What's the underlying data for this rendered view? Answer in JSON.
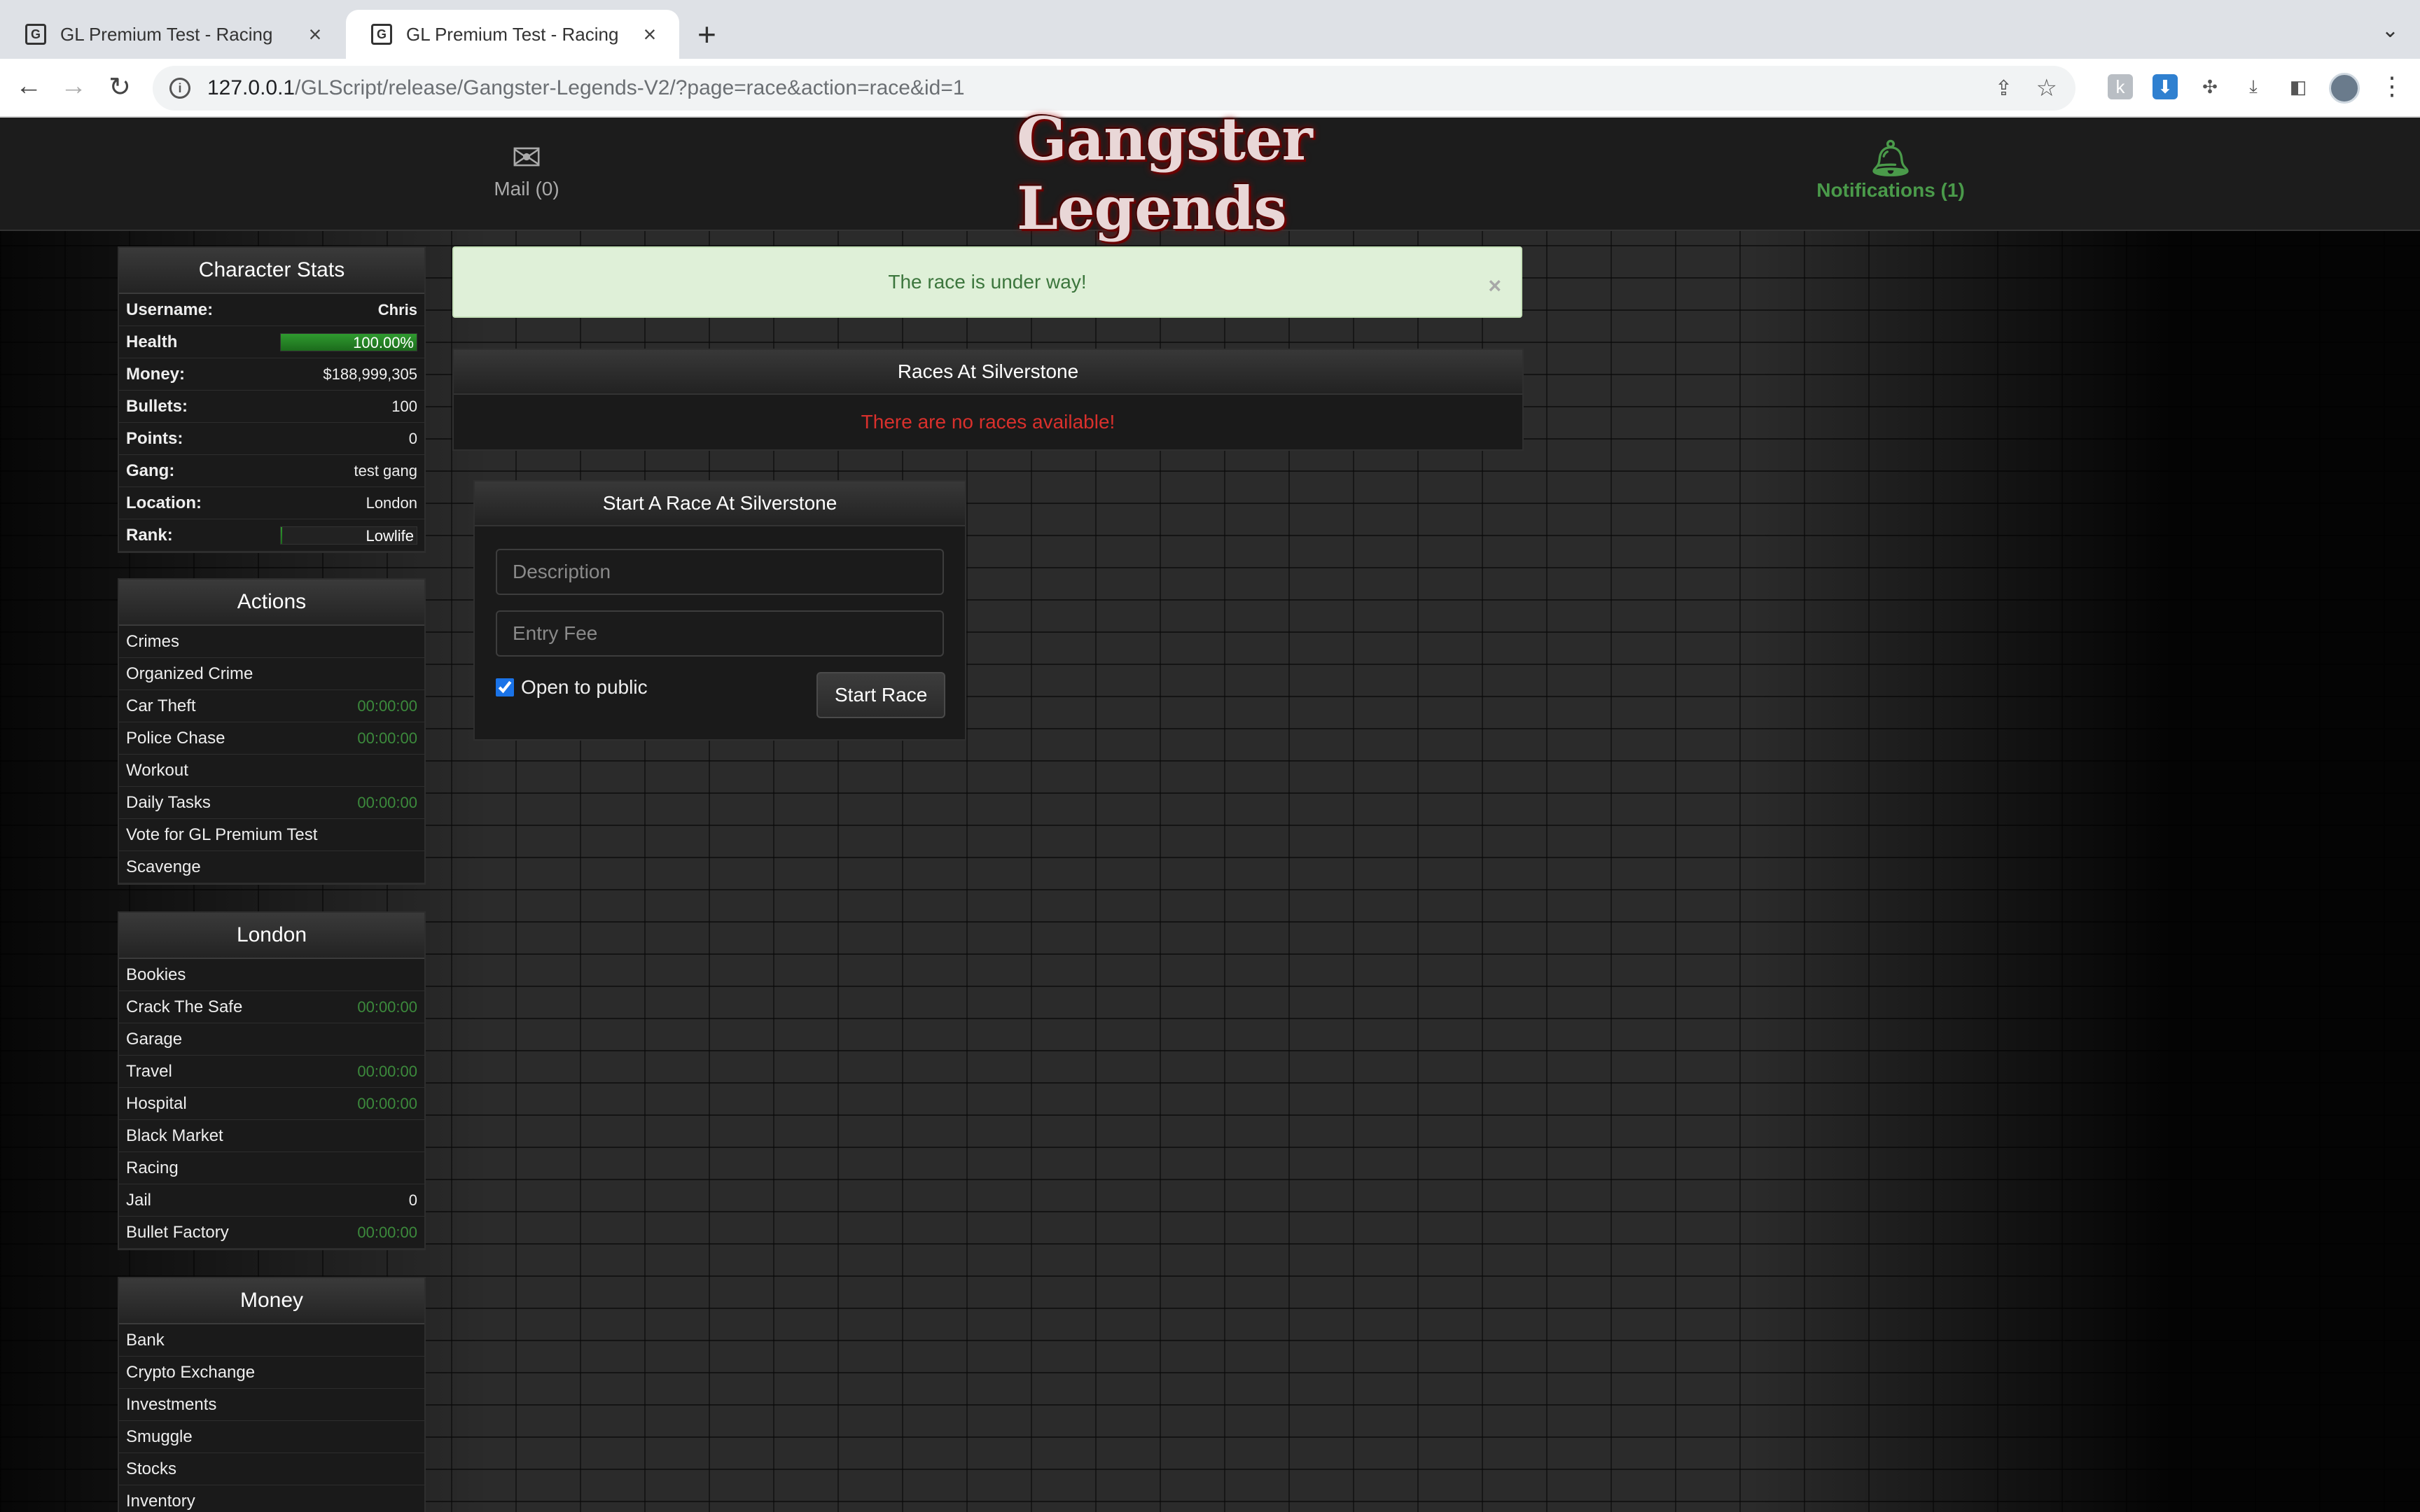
{
  "browser": {
    "tabs": [
      {
        "title": "GL Premium Test - Racing",
        "active": false
      },
      {
        "title": "GL Premium Test - Racing",
        "active": true
      }
    ],
    "url_host": "127.0.0.1",
    "url_path": "/GLScript/release/Gangster-Legends-V2/?page=race&action=race&id=1"
  },
  "header": {
    "mail_label": "Mail (0)",
    "logo_text": "Gangster Legends",
    "notifications_label": "Notifications (1)"
  },
  "character_stats": {
    "title": "Character Stats",
    "username_label": "Username:",
    "username": "Chris",
    "health_label": "Health",
    "health_text": "100.00%",
    "health_fraction": 1.0,
    "money_label": "Money:",
    "money": "$188,999,305",
    "bullets_label": "Bullets:",
    "bullets": "100",
    "points_label": "Points:",
    "points": "0",
    "gang_label": "Gang:",
    "gang": "test gang",
    "location_label": "Location:",
    "location": "London",
    "rank_label": "Rank:",
    "rank": "Lowlife",
    "rank_fraction": 0.01
  },
  "actions": {
    "title": "Actions",
    "items": [
      {
        "label": "Crimes",
        "value": ""
      },
      {
        "label": "Organized Crime",
        "value": ""
      },
      {
        "label": "Car Theft",
        "value": "00:00:00"
      },
      {
        "label": "Police Chase",
        "value": "00:00:00"
      },
      {
        "label": "Workout",
        "value": ""
      },
      {
        "label": "Daily Tasks",
        "value": "00:00:00"
      },
      {
        "label": "Vote for GL Premium Test",
        "value": ""
      },
      {
        "label": "Scavenge",
        "value": ""
      }
    ]
  },
  "london": {
    "title": "London",
    "items": [
      {
        "label": "Bookies",
        "value": ""
      },
      {
        "label": "Crack The Safe",
        "value": "00:00:00"
      },
      {
        "label": "Garage",
        "value": ""
      },
      {
        "label": "Travel",
        "value": "00:00:00"
      },
      {
        "label": "Hospital",
        "value": "00:00:00"
      },
      {
        "label": "Black Market",
        "value": ""
      },
      {
        "label": "Racing",
        "value": ""
      },
      {
        "label": "Jail",
        "value": "0"
      },
      {
        "label": "Bullet Factory",
        "value": "00:00:00"
      }
    ]
  },
  "money": {
    "title": "Money",
    "items": [
      {
        "label": "Bank"
      },
      {
        "label": "Crypto Exchange"
      },
      {
        "label": "Investments"
      },
      {
        "label": "Smuggle"
      },
      {
        "label": "Stocks"
      },
      {
        "label": "Inventory"
      }
    ]
  },
  "alert": {
    "message": "The race is under way!",
    "close": "×"
  },
  "races": {
    "title": "Races At Silverstone",
    "empty_message": "There are no races available!"
  },
  "start_race": {
    "title": "Start A Race At Silverstone",
    "description_placeholder": "Description",
    "description_value": "",
    "entry_fee_placeholder": "Entry Fee",
    "entry_fee_value": "",
    "open_to_public_label": "Open to public",
    "open_to_public_checked": true,
    "submit_label": "Start Race"
  },
  "colors": {
    "timer_green": "#3c8a3c",
    "error_red": "#d9302c",
    "success_bg": "#dff0d8",
    "success_text": "#3c763d",
    "notification_green": "#4a9a4a"
  }
}
